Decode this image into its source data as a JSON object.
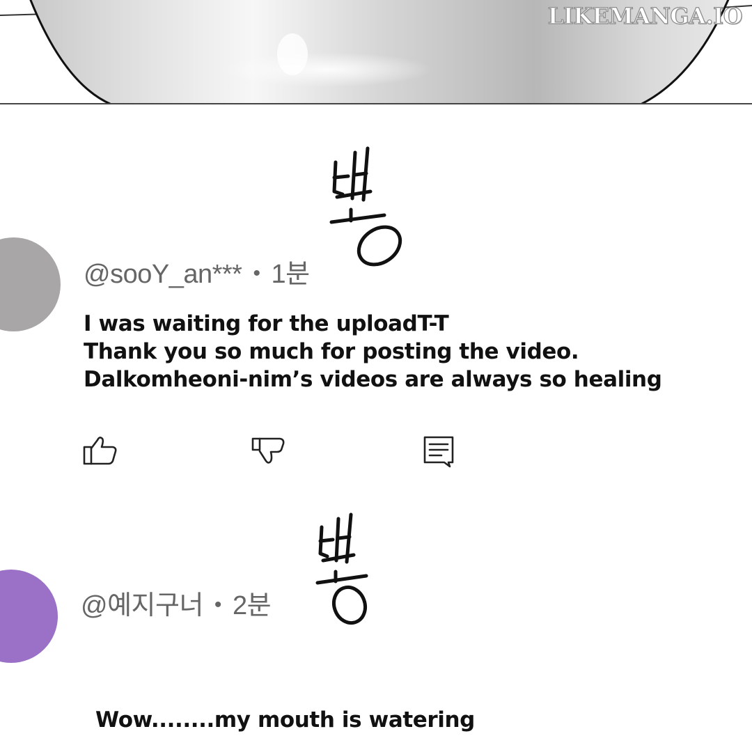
{
  "watermark": {
    "text": "LIKEMANGA.IO"
  },
  "comments": [
    {
      "avatar_color": "#a8a6a7",
      "username": "@sooY_an***",
      "separator": "•",
      "time": "1분",
      "lines": [
        "I was waiting for the uploadT-T",
        "Thank you so much for posting the video.",
        "Dalkomheoni-nim’s videos are always so healing"
      ],
      "actions": {
        "like_icon": "thumbs-up-icon",
        "dislike_icon": "thumbs-down-icon",
        "reply_icon": "comment-icon"
      },
      "sfx": "뿅"
    },
    {
      "avatar_color": "#9a71c6",
      "username": "@예지구너",
      "separator": "•",
      "time": "2분",
      "lines": [
        "Wow........my mouth is watering"
      ],
      "sfx": "뿅"
    }
  ]
}
